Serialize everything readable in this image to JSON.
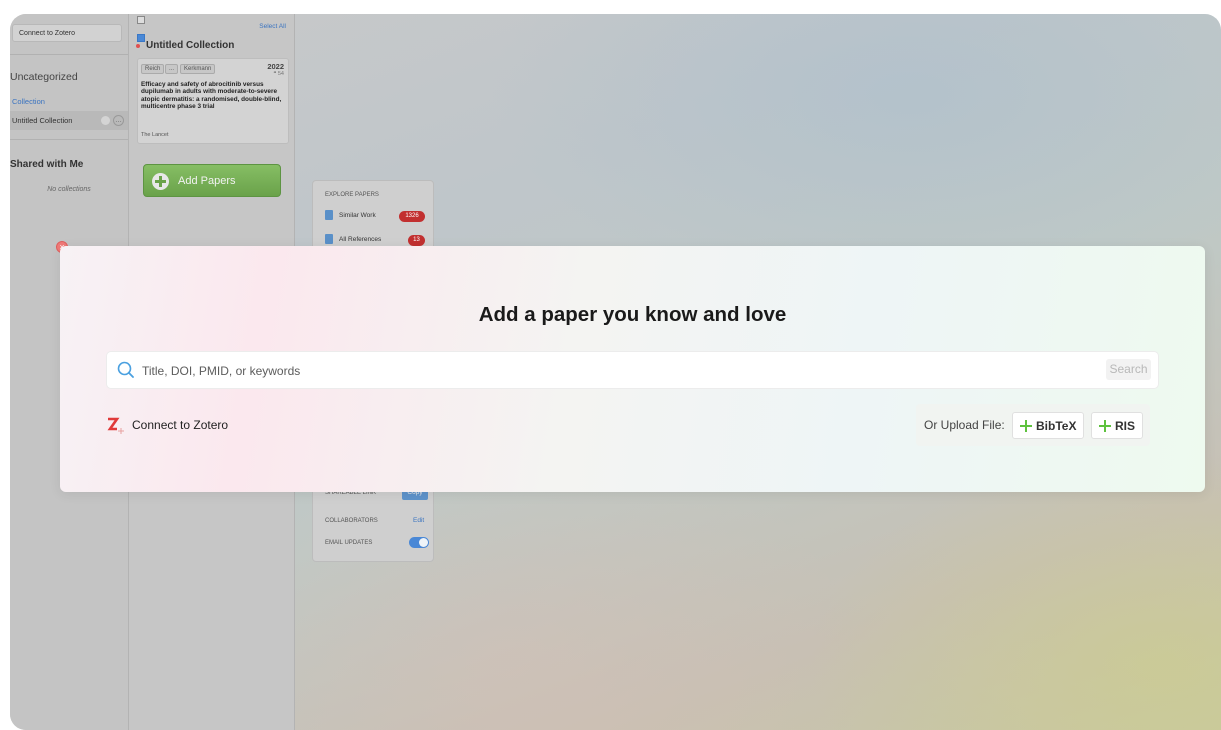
{
  "sidebar": {
    "connect_zotero": "Connect to Zotero",
    "uncategorized": "Uncategorized",
    "collection_link": "Collection",
    "untitled_collection": "Untitled Collection",
    "shared_heading": "Shared with Me",
    "no_collections": "No collections"
  },
  "collection_panel": {
    "select_all": "Select All",
    "title": "Untitled Collection",
    "paper": {
      "author_first": "Reich",
      "author_ellipsis": "...",
      "author_last": "Kerkmann",
      "year": "2022",
      "citations": "54",
      "title": "Efficacy and safety of abrocitinib versus dupilumab in adults with moderate-to-severe atopic dermatitis: a randomised, double-blind, multicentre phase 3 trial",
      "journal": "The Lancet"
    },
    "add_papers": "Add Papers"
  },
  "explore": {
    "heading": "EXPLORE PAPERS",
    "similar_work": "Similar Work",
    "similar_count": "1326",
    "all_references": "All References",
    "references_count": "13",
    "shareable_link": "SHAREABLE LINK",
    "copy": "Copy",
    "collaborators": "COLLABORATORS",
    "edit": "Edit",
    "email_updates": "EMAIL UPDATES",
    "email_updates_enabled": true
  },
  "modal": {
    "title": "Add a paper you know and love",
    "search_placeholder": "Title, DOI, PMID, or keywords",
    "search_value": "",
    "search_button": "Search",
    "zotero_label": "Connect to Zotero",
    "upload_label": "Or Upload File:",
    "bibtex": "BibTeX",
    "ris": "RIS"
  },
  "colors": {
    "accent_blue": "#3b74c0",
    "add_green": "#6aa24a",
    "badge_red": "#c23030",
    "zotero_red": "#e03a3a",
    "close_red": "#f07a78"
  }
}
